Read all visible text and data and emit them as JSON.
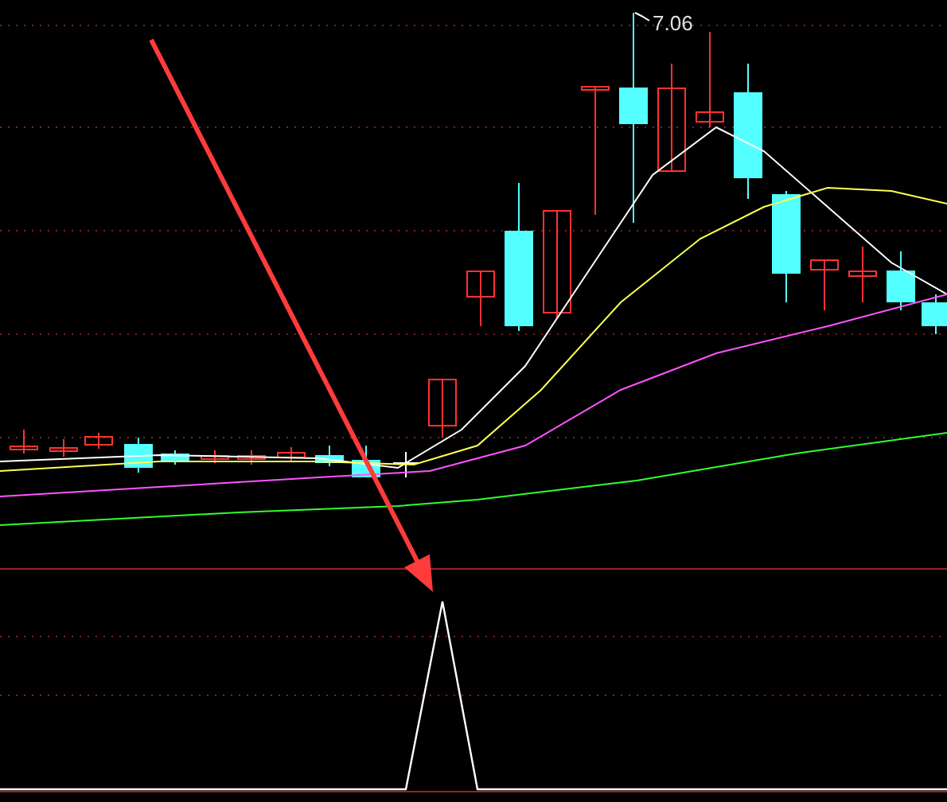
{
  "price_chart": {
    "high_label": "7.06"
  }
}
